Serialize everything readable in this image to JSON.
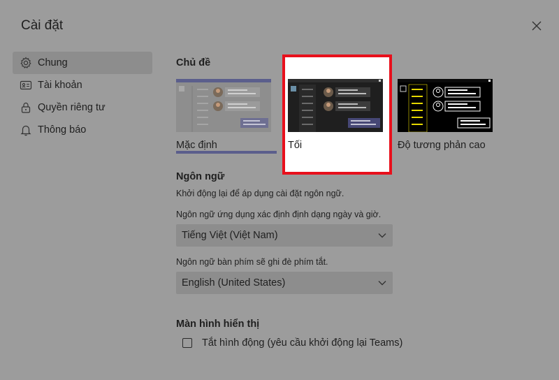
{
  "dialog": {
    "title": "Cài đặt"
  },
  "sidebar": {
    "items": [
      {
        "label": "Chung",
        "icon": "gear-icon",
        "active": true
      },
      {
        "label": "Tài khoản",
        "icon": "id-card-icon",
        "active": false
      },
      {
        "label": "Quyền riêng tư",
        "icon": "lock-icon",
        "active": false
      },
      {
        "label": "Thông báo",
        "icon": "bell-icon",
        "active": false
      }
    ]
  },
  "theme": {
    "heading": "Chủ đề",
    "options": [
      {
        "label": "Mặc định",
        "selected": true
      },
      {
        "label": "Tối",
        "selected": false
      },
      {
        "label": "Độ tương phản cao",
        "selected": false
      }
    ]
  },
  "language": {
    "heading": "Ngôn ngữ",
    "restart_note": "Khởi động lại để áp dụng cài đặt ngôn ngữ.",
    "app_language_desc": "Ngôn ngữ ứng dụng xác định định dạng ngày và giờ.",
    "app_language_value": "Tiếng Việt (Việt Nam)",
    "keyboard_desc": "Ngôn ngữ bàn phím sẽ ghi đè phím tắt.",
    "keyboard_value": "English (United States)"
  },
  "display": {
    "heading": "Màn hình hiển thị",
    "disable_animation_label": "Tắt hình động (yêu cầu khởi động lại Teams)",
    "disable_animation_checked": false
  },
  "colors": {
    "highlight_border": "#e8101c",
    "accent": "#5b5e8c",
    "high_contrast_yellow": "#e6d800"
  }
}
